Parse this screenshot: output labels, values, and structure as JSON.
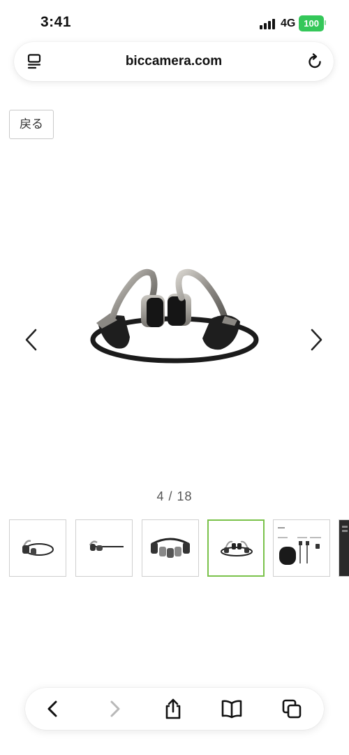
{
  "status_bar": {
    "time": "3:41",
    "network": "4G",
    "battery": "100"
  },
  "browser": {
    "url": "biccamera.com",
    "reader_icon": "reader-icon",
    "reload_icon": "reload-icon"
  },
  "page": {
    "back_label": "戻る",
    "gallery": {
      "current": 4,
      "total": 18,
      "counter_text": "4 / 18"
    }
  },
  "colors": {
    "active_thumb_border": "#7ac24a",
    "battery": "#34c759"
  },
  "toolbar": {
    "icons": [
      "back-icon",
      "forward-icon",
      "share-icon",
      "bookmarks-icon",
      "tabs-icon"
    ]
  }
}
